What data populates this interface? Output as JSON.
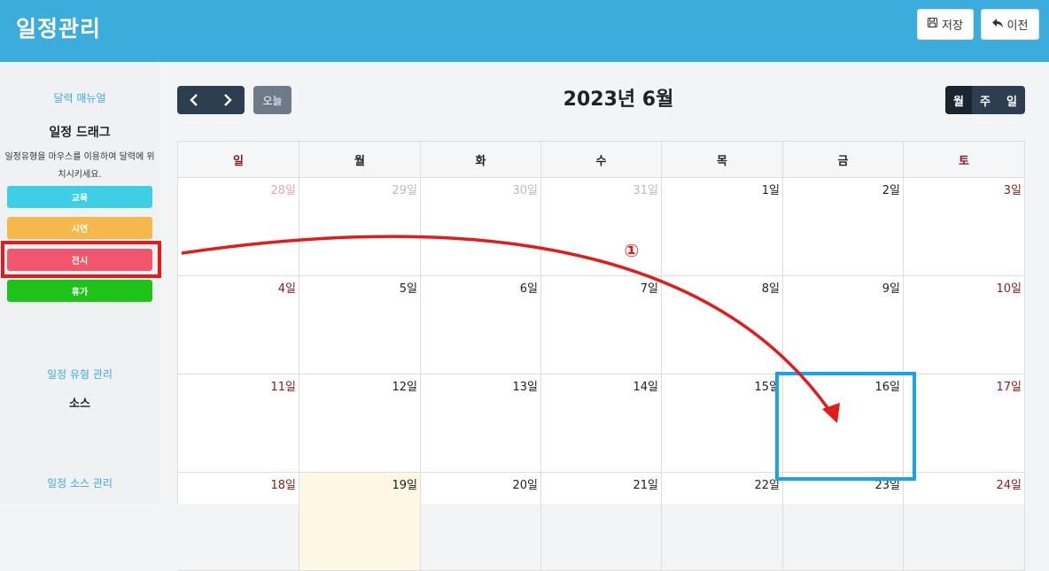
{
  "header": {
    "title": "일정관리",
    "save_label": "저장",
    "back_label": "이전",
    "bg_color": "#3bacdb"
  },
  "sidebar": {
    "manual_link": "달력 매뉴얼",
    "drag_heading": "일정 드래그",
    "drag_desc": "일정유형을 마우스를 이용하여 달력에 위치시키세요.",
    "event_types": [
      {
        "label": "교육",
        "color": "#3dcfe6"
      },
      {
        "label": "시연",
        "color": "#f5b84a"
      },
      {
        "label": "전시",
        "color": "#f2566c"
      },
      {
        "label": "휴가",
        "color": "#1ec31a"
      }
    ],
    "type_manage_link": "일정 유형 관리",
    "source_heading": "소스",
    "source_manage_link": "일정 소스 관리"
  },
  "toolbar": {
    "prev_icon": "‹",
    "next_icon": "›",
    "today_label": "오늘",
    "title": "2023년 6월",
    "views": [
      "월",
      "주",
      "일"
    ],
    "active_view": "월"
  },
  "calendar": {
    "weekdays": [
      "일",
      "월",
      "화",
      "수",
      "목",
      "금",
      "토"
    ],
    "weeks": [
      [
        "28일",
        "29일",
        "30일",
        "31일",
        "1일",
        "2일",
        "3일"
      ],
      [
        "4일",
        "5일",
        "6일",
        "7일",
        "8일",
        "9일",
        "10일"
      ],
      [
        "11일",
        "12일",
        "13일",
        "14일",
        "15일",
        "16일",
        "17일"
      ],
      [
        "18일",
        "19일",
        "20일",
        "21일",
        "22일",
        "23일",
        "24일"
      ]
    ],
    "today": "19일"
  },
  "annotation": {
    "step_label": "①",
    "highlight_color": "#e31b1b",
    "target_color": "#1aa3e8"
  }
}
